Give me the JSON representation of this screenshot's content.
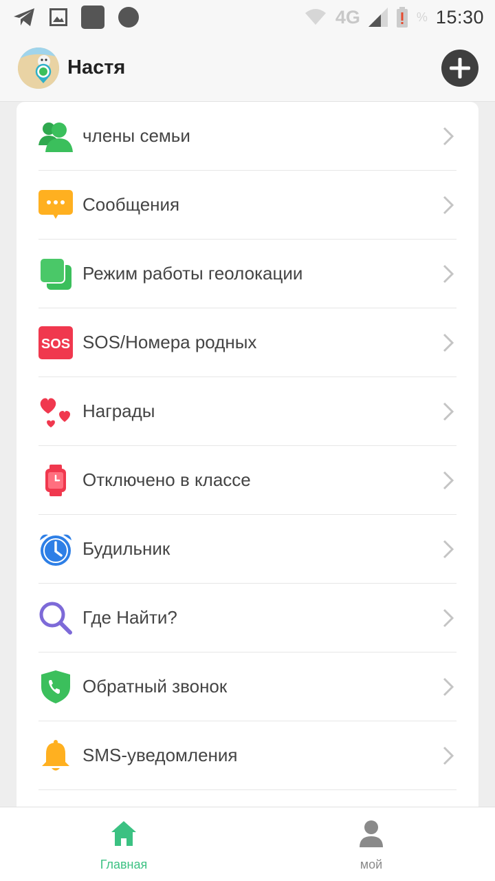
{
  "status_bar": {
    "time": "15:30",
    "network": "4G",
    "battery_percent_label": "%",
    "icons": [
      "telegram-icon",
      "gallery-icon",
      "app-square-icon",
      "circle-icon",
      "wifi-icon",
      "signal-icon",
      "battery-alert-icon"
    ]
  },
  "header": {
    "title": "Настя",
    "add_icon": "plus-circle-icon"
  },
  "menu": {
    "items": [
      {
        "label": "члены семьи",
        "icon": "family-members-icon",
        "color": "#3bbf5c"
      },
      {
        "label": "Сообщения",
        "icon": "chat-bubble-icon",
        "color": "#ffb020"
      },
      {
        "label": "Режим работы геолокации",
        "icon": "location-mode-icon",
        "color": "#3bbf5c"
      },
      {
        "label": "SOS/Номера родных",
        "icon": "sos-icon",
        "color": "#f0384e"
      },
      {
        "label": "Награды",
        "icon": "hearts-icon",
        "color": "#f0384e"
      },
      {
        "label": "Отключено в классе",
        "icon": "watch-icon",
        "color": "#f0384e"
      },
      {
        "label": "Будильник",
        "icon": "alarm-clock-icon",
        "color": "#2e7fe6"
      },
      {
        "label": "Где Найти?",
        "icon": "search-icon",
        "color": "#7d6ad8"
      },
      {
        "label": "Обратный звонок",
        "icon": "phone-shield-icon",
        "color": "#3bbf5c"
      },
      {
        "label": "SMS-уведомления",
        "icon": "bell-icon",
        "color": "#ffb020"
      }
    ],
    "sos_text": "SOS"
  },
  "bottom_nav": {
    "tabs": [
      {
        "label": "Главная",
        "icon": "home-icon",
        "active": true,
        "color": "#3bc182"
      },
      {
        "label": "мой",
        "icon": "profile-icon",
        "active": false,
        "color": "#8a8a8a"
      }
    ]
  }
}
